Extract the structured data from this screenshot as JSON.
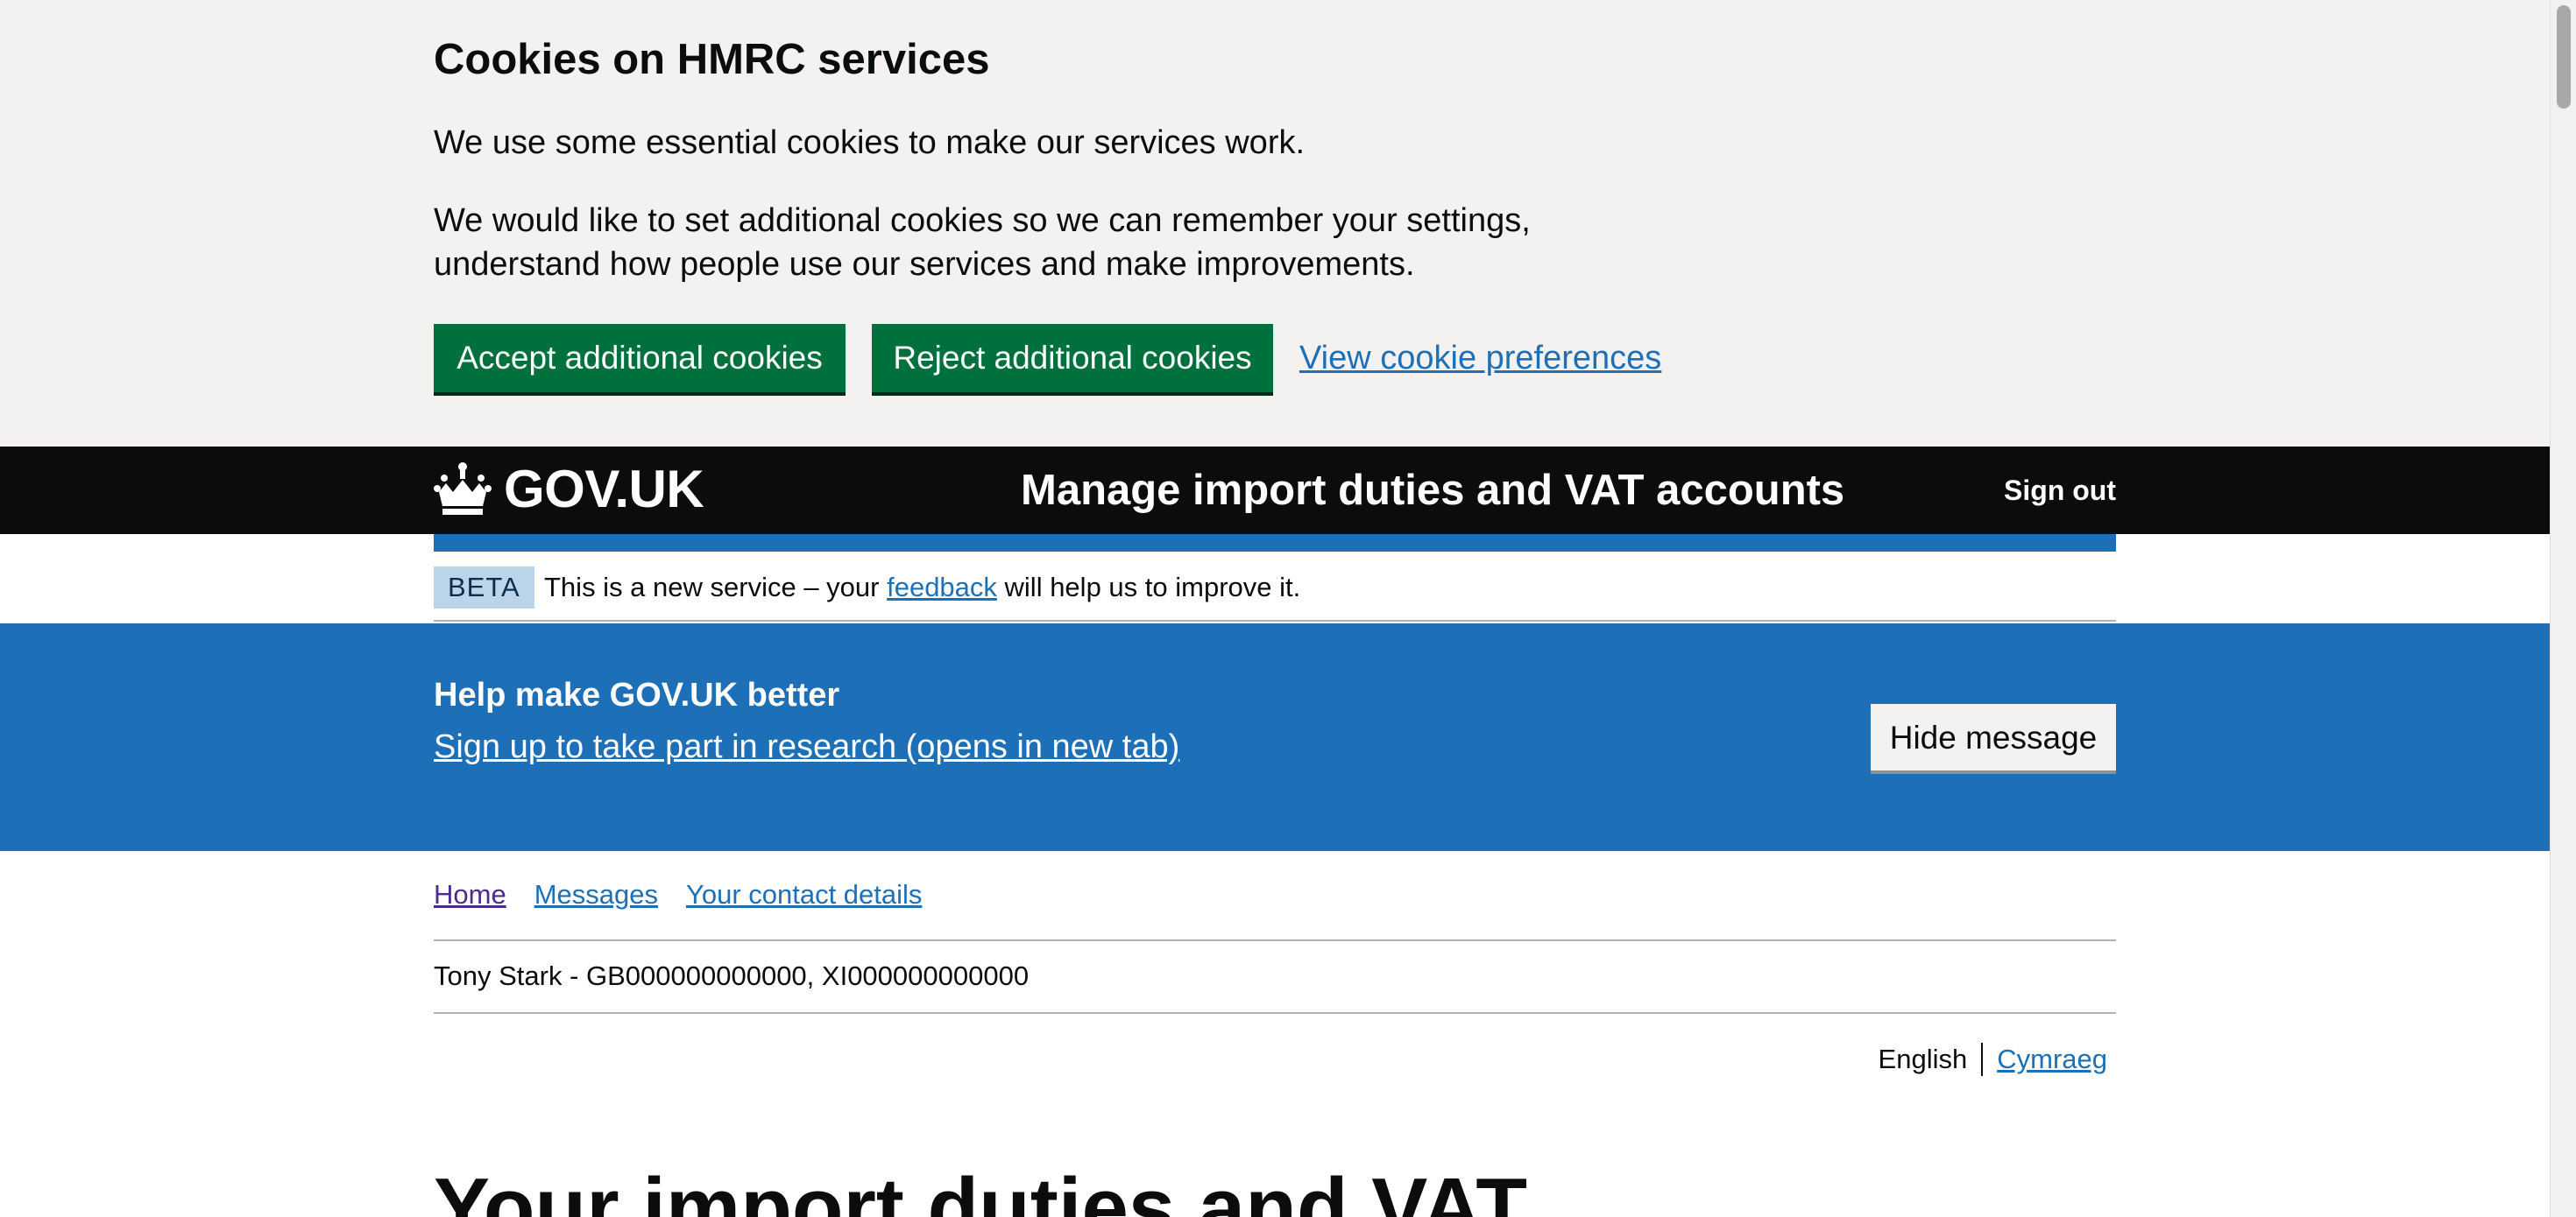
{
  "cookie_banner": {
    "title": "Cookies on HMRC services",
    "paragraph_1": "We use some essential cookies to make our services work.",
    "paragraph_2_line_1": "We would like to set additional cookies so we can remember your settings,",
    "paragraph_2_line_2": "understand how people use our services and make improvements.",
    "accept_label": "Accept additional cookies",
    "reject_label": "Reject additional cookies",
    "preferences_link": "View cookie preferences"
  },
  "header": {
    "logo_text": "GOV.UK",
    "service_name": "Manage import duties and VAT accounts",
    "sign_out": "Sign out"
  },
  "phase_banner": {
    "tag": "BETA",
    "text_before": "This is a new service – your ",
    "link": "feedback",
    "text_after": " will help us to improve it."
  },
  "research_banner": {
    "title": "Help make GOV.UK better",
    "link": "Sign up to take part in research (opens in new tab)",
    "hide_button": "Hide message"
  },
  "subnav": {
    "items": [
      "Home",
      "Messages",
      "Your contact details"
    ]
  },
  "user": {
    "details": "Tony Stark - GB000000000000, XI000000000000"
  },
  "language": {
    "current": "English",
    "other": "Cymraeg"
  },
  "main": {
    "heading": "Your import duties and VAT"
  },
  "colors": {
    "link": "#1d70b8",
    "brand_blue": "#1d70b8",
    "green_button": "#00703c",
    "header_bg": "#0b0c0c",
    "cookie_bg": "#f3f2f1"
  }
}
